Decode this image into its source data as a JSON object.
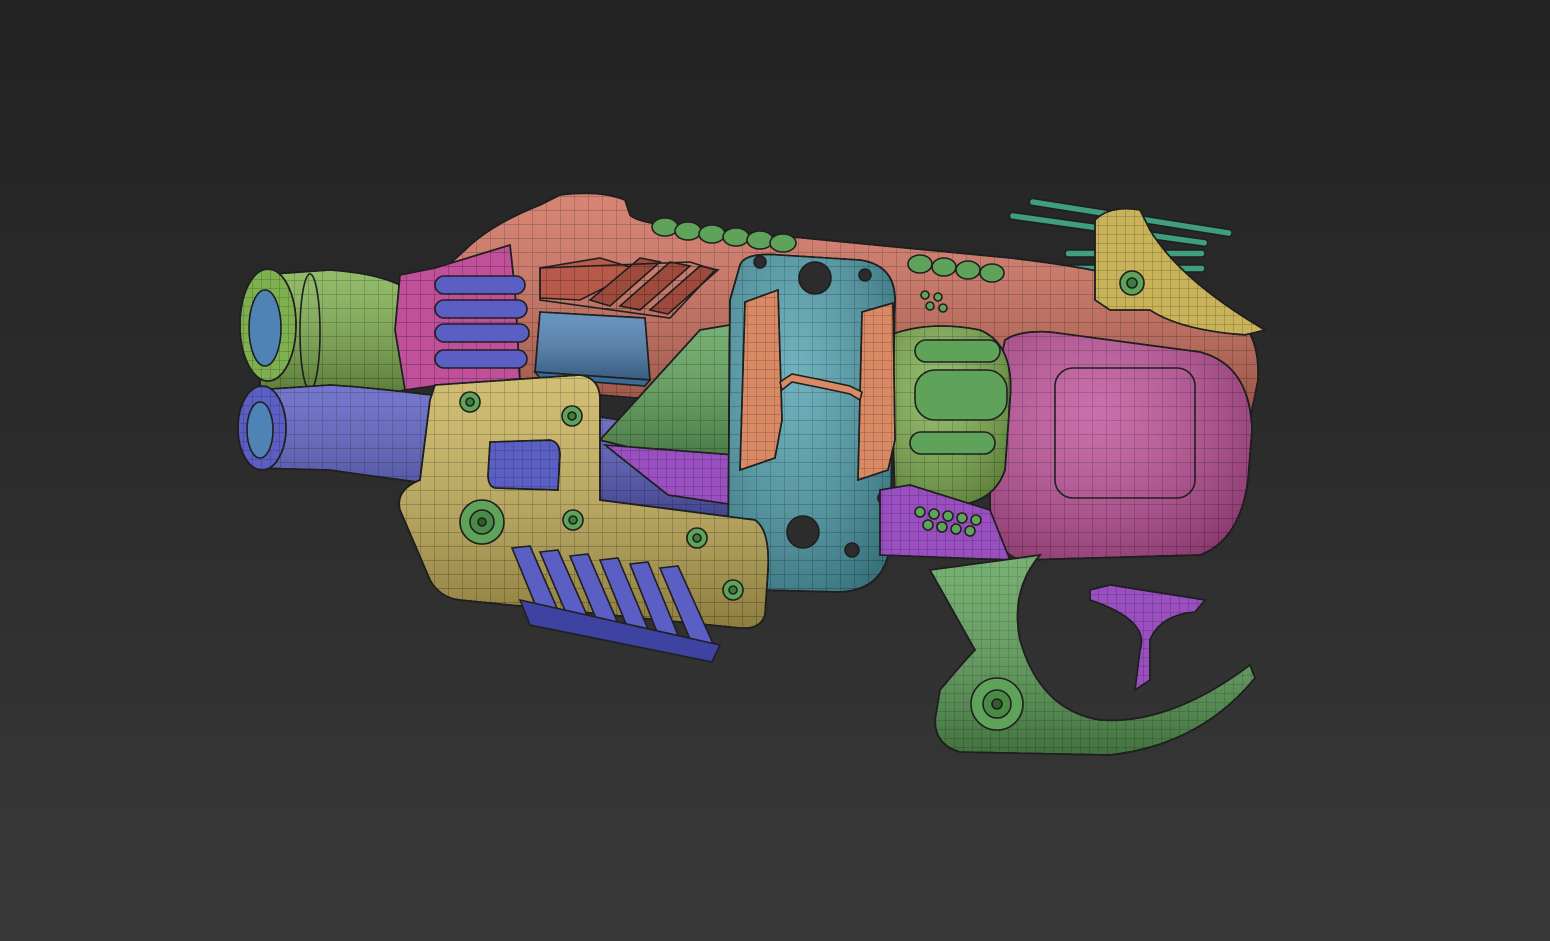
{
  "viewport": {
    "background_top": "#232323",
    "background_bottom": "#393939"
  },
  "model": {
    "subject": "stylized-blaster-gun",
    "display_mode": "polygroups-with-wireframe",
    "colors": {
      "salmon": "#d06f5c",
      "green": "#5fa35a",
      "lime": "#7fb04f",
      "blue_purple": "#5b5fc4",
      "magenta": "#c0509a",
      "purple": "#9a4fc0",
      "yellow": "#c9b35a",
      "cyan": "#4fa0ae",
      "teal_green": "#3f9e7e",
      "orange": "#d98a64",
      "steel_blue": "#4f82b5"
    }
  }
}
